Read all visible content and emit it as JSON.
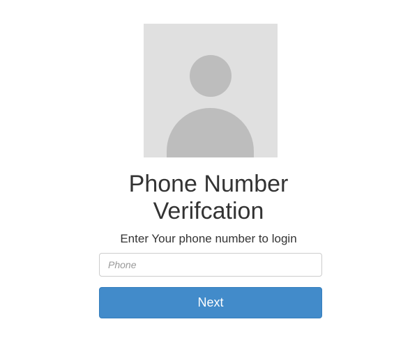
{
  "avatar": {
    "icon": "user-silhouette-icon"
  },
  "heading": {
    "line1": "Phone Number",
    "line2": "Verifcation"
  },
  "subtitle": "Enter Your phone number to login",
  "phone_field": {
    "value": "",
    "placeholder": "Phone"
  },
  "next_button": {
    "label": "Next"
  },
  "colors": {
    "background": "#ffffff",
    "avatar_background": "#e0e0e0",
    "avatar_silhouette": "#bdbdbd",
    "text": "#333333",
    "input_border": "#cccccc",
    "placeholder": "#999999",
    "button_background": "#428bca",
    "button_border": "#357ebd",
    "button_text": "#ffffff"
  }
}
